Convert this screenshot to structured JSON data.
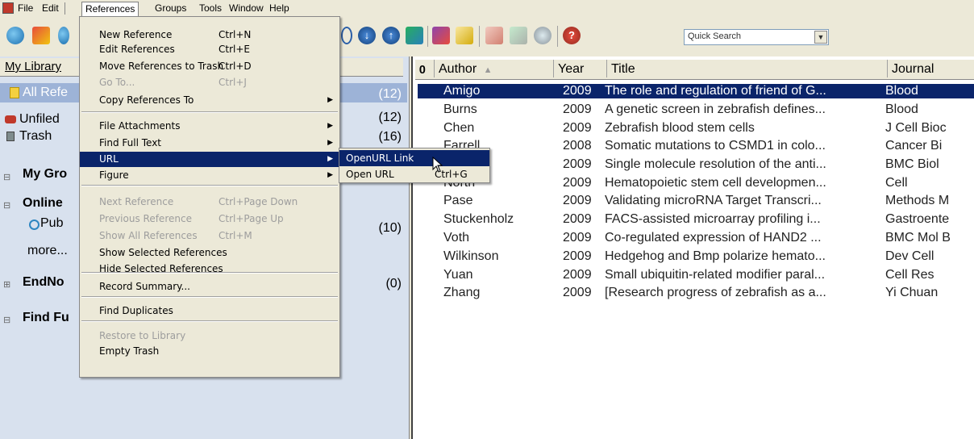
{
  "menubar": {
    "items": [
      "File",
      "Edit",
      "References",
      "Groups",
      "Tools",
      "Window",
      "Help"
    ]
  },
  "toolbar": {
    "quick_search_placeholder": "Quick Search"
  },
  "left_pane": {
    "header": "My Library",
    "rows": [
      {
        "label": "All Refe",
        "count": "(12)"
      },
      {
        "label": "Unfiled",
        "count": "(12)"
      },
      {
        "label": "Trash",
        "count": "(16)"
      },
      {
        "label": "My Gro",
        "count": ""
      },
      {
        "label": "Online",
        "count": ""
      },
      {
        "label": "Pub",
        "count": "(10)"
      },
      {
        "label": "more...",
        "count": ""
      },
      {
        "label": "EndNo",
        "count": "(0)"
      },
      {
        "label": "Find Fu",
        "count": ""
      }
    ]
  },
  "table": {
    "columns": [
      "Author",
      "Year",
      "Title",
      "Journal"
    ],
    "sort_indicator": "▲",
    "rows": [
      {
        "author": "Amigo",
        "year": "2009",
        "title": "The role and regulation of friend of G...",
        "journal": "Blood",
        "selected": true
      },
      {
        "author": "Burns",
        "year": "2009",
        "title": "A genetic screen in zebrafish defines...",
        "journal": "Blood"
      },
      {
        "author": "Chen",
        "year": "2009",
        "title": "Zebrafish blood stem cells",
        "journal": "J Cell Bioc"
      },
      {
        "author": "Farrell",
        "year": "2008",
        "title": "Somatic mutations to CSMD1 in colo...",
        "journal": "Cancer Bi"
      },
      {
        "author": "",
        "year": "2009",
        "title": "Single molecule resolution of the anti...",
        "journal": "BMC Biol"
      },
      {
        "author": "North",
        "year": "2009",
        "title": "Hematopoietic stem cell developmen...",
        "journal": "Cell"
      },
      {
        "author": "Pase",
        "year": "2009",
        "title": "Validating microRNA Target Transcri...",
        "journal": "Methods M"
      },
      {
        "author": "Stuckenholz",
        "year": "2009",
        "title": "FACS-assisted microarray profiling i...",
        "journal": "Gastroente"
      },
      {
        "author": "Voth",
        "year": "2009",
        "title": "Co-regulated expression of HAND2 ...",
        "journal": "BMC Mol B"
      },
      {
        "author": "Wilkinson",
        "year": "2009",
        "title": "Hedgehog and Bmp polarize hemato...",
        "journal": "Dev Cell"
      },
      {
        "author": "Yuan",
        "year": "2009",
        "title": "Small ubiquitin-related modifier paral...",
        "journal": "Cell Res"
      },
      {
        "author": "Zhang",
        "year": "2009",
        "title": "[Research progress of zebrafish as a...",
        "journal": "Yi Chuan"
      }
    ]
  },
  "menu": {
    "items": [
      {
        "label": "New Reference",
        "shortcut": "Ctrl+N"
      },
      {
        "label": "Edit References",
        "shortcut": "Ctrl+E"
      },
      {
        "label": "Move References to Trash",
        "shortcut": "Ctrl+D"
      },
      {
        "label": "Go To...",
        "shortcut": "Ctrl+J",
        "disabled": true
      },
      {
        "label": "Copy References To",
        "submenu": true
      },
      {
        "label": "File Attachments",
        "submenu": true
      },
      {
        "label": "Find Full Text",
        "submenu": true
      },
      {
        "label": "URL",
        "submenu": true,
        "highlighted": true
      },
      {
        "label": "Figure",
        "submenu": true
      },
      {
        "label": "Next Reference",
        "shortcut": "Ctrl+Page Down",
        "disabled": true
      },
      {
        "label": "Previous Reference",
        "shortcut": "Ctrl+Page Up",
        "disabled": true
      },
      {
        "label": "Show All References",
        "shortcut": "Ctrl+M",
        "disabled": true
      },
      {
        "label": "Show Selected References"
      },
      {
        "label": "Hide Selected References"
      },
      {
        "label": "Record Summary..."
      },
      {
        "label": "Find Duplicates"
      },
      {
        "label": "Restore to Library",
        "disabled": true
      },
      {
        "label": "Empty Trash"
      }
    ]
  },
  "submenu": {
    "items": [
      {
        "label": "OpenURL Link",
        "shortcut": ""
      },
      {
        "label": "Open URL",
        "shortcut": "Ctrl+G"
      }
    ]
  },
  "colors": {
    "selection": "#0a246a",
    "left_pane_bg": "#d8e1ee",
    "chrome": "#ece9d8"
  }
}
